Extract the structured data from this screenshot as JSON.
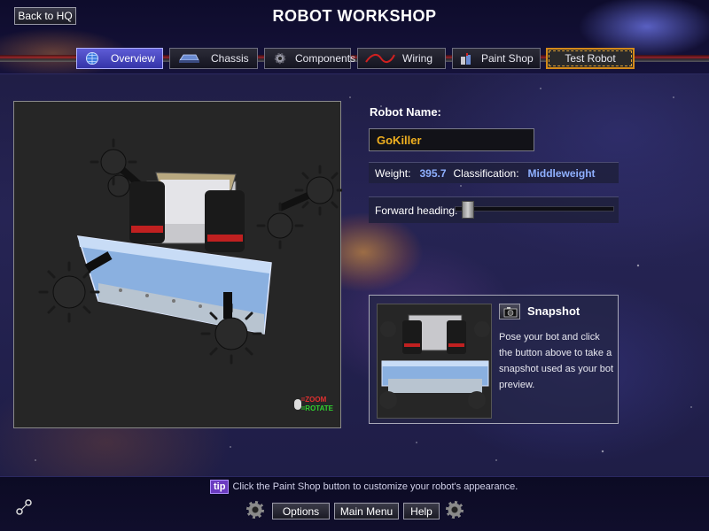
{
  "header": {
    "back_label": "Back to HQ",
    "title": "ROBOT WORKSHOP"
  },
  "tabs": [
    {
      "label": "Overview",
      "icon": "globe-icon",
      "active": true
    },
    {
      "label": "Chassis",
      "icon": "chassis-icon",
      "active": false
    },
    {
      "label": "Components",
      "icon": "gear-icon",
      "active": false
    },
    {
      "label": "Wiring",
      "icon": "wire-icon",
      "active": false
    },
    {
      "label": "Paint Shop",
      "icon": "paint-cans-icon",
      "active": false
    },
    {
      "label": "Test Robot",
      "icon": "",
      "active": false
    }
  ],
  "viewport": {
    "zoom_label": "=ZOOM",
    "rotate_label": "=ROTATE"
  },
  "robot": {
    "name_label": "Robot Name:",
    "name_value": "GoKiller",
    "weight_label": "Weight:",
    "weight_value": "395.7",
    "class_label": "Classification:",
    "class_value": "Middleweight",
    "heading_label": "Forward heading:",
    "heading_fraction": 0.04
  },
  "snapshot": {
    "title": "Snapshot",
    "description": "Pose your bot and click the button above to take a snapshot used as your bot preview."
  },
  "footer": {
    "tip_badge": "tip",
    "tip_text": "Click the Paint Shop button to customize your robot's appearance.",
    "options_label": "Options",
    "main_menu_label": "Main Menu",
    "help_label": "Help"
  },
  "colors": {
    "accent_blue": "#8fb0ff",
    "name_gold": "#f0b020",
    "active_tab": "#4a48c4",
    "tip_purple": "#6a3ac0"
  }
}
